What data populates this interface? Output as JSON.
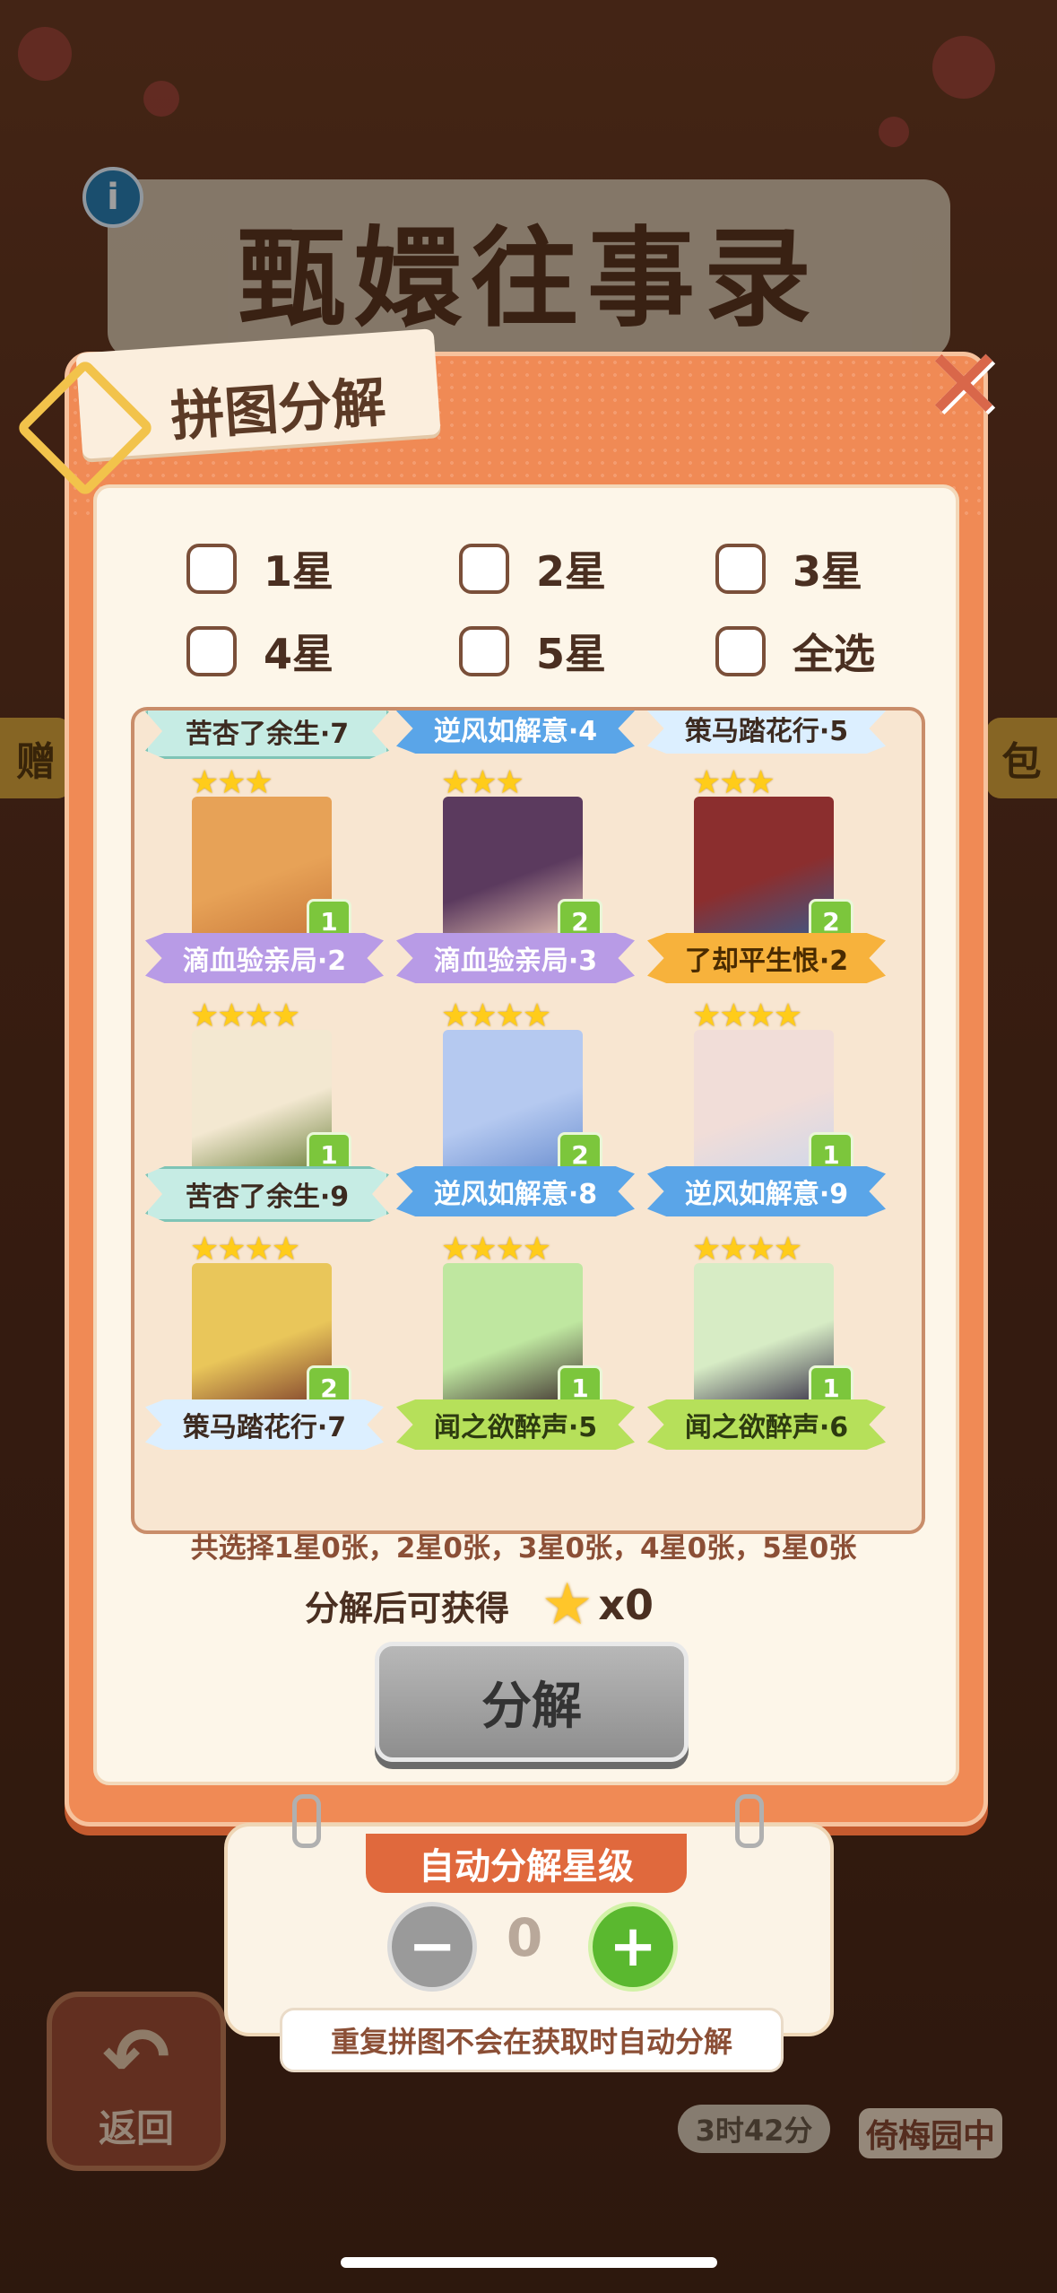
{
  "background": {
    "game_title": "甄嬛往事录",
    "back_label": "返回",
    "timer_text": "3时42分",
    "garden_label": "倚梅园中"
  },
  "dialog": {
    "title": "拼图分解",
    "filters": [
      {
        "label": "1星"
      },
      {
        "label": "2星"
      },
      {
        "label": "3星"
      },
      {
        "label": "4星"
      },
      {
        "label": "5星"
      },
      {
        "label": "全选"
      }
    ],
    "pieces": [
      {
        "name": "苦杏了余生·7",
        "stars": 0,
        "count": "",
        "banner": "mint",
        "partial": true
      },
      {
        "name": "逆风如解意·4",
        "stars": 0,
        "count": "",
        "banner": "blue",
        "partial": true
      },
      {
        "name": "策马踏花行·5",
        "stars": 0,
        "count": "",
        "banner": "ice",
        "partial": true
      },
      {
        "name": "滴血验亲局·2",
        "stars": 3,
        "count": "1",
        "banner": "purple"
      },
      {
        "name": "滴血验亲局·3",
        "stars": 3,
        "count": "2",
        "banner": "purple"
      },
      {
        "name": "了却平生恨·2",
        "stars": 3,
        "count": "2",
        "banner": "orange"
      },
      {
        "name": "苦杏了余生·9",
        "stars": 4,
        "count": "1",
        "banner": "mint"
      },
      {
        "name": "逆风如解意·8",
        "stars": 4,
        "count": "2",
        "banner": "blue"
      },
      {
        "name": "逆风如解意·9",
        "stars": 4,
        "count": "1",
        "banner": "blue"
      },
      {
        "name": "策马踏花行·7",
        "stars": 4,
        "count": "2",
        "banner": "ice"
      },
      {
        "name": "闻之欲醉声·5",
        "stars": 4,
        "count": "1",
        "banner": "lime"
      },
      {
        "name": "闻之欲醉声·6",
        "stars": 4,
        "count": "1",
        "banner": "lime"
      }
    ],
    "summary": "共选择1星0张，2星0张，3星0张，4星0张，5星0张",
    "reward_label": "分解后可获得",
    "reward_multiplier": "x0",
    "decompose_button": "分解"
  },
  "auto": {
    "header": "自动分解星级",
    "level": "0",
    "minus_symbol": "−",
    "plus_symbol": "+",
    "tip": "重复拼图不会在获取时自动分解"
  },
  "colors": {
    "dialog_orange": "#f08a55",
    "panel_cream": "#fdf6e9",
    "text_brown": "#4a2f21",
    "star_yellow": "#ffcc1a",
    "accent_green": "#5ab82f"
  }
}
